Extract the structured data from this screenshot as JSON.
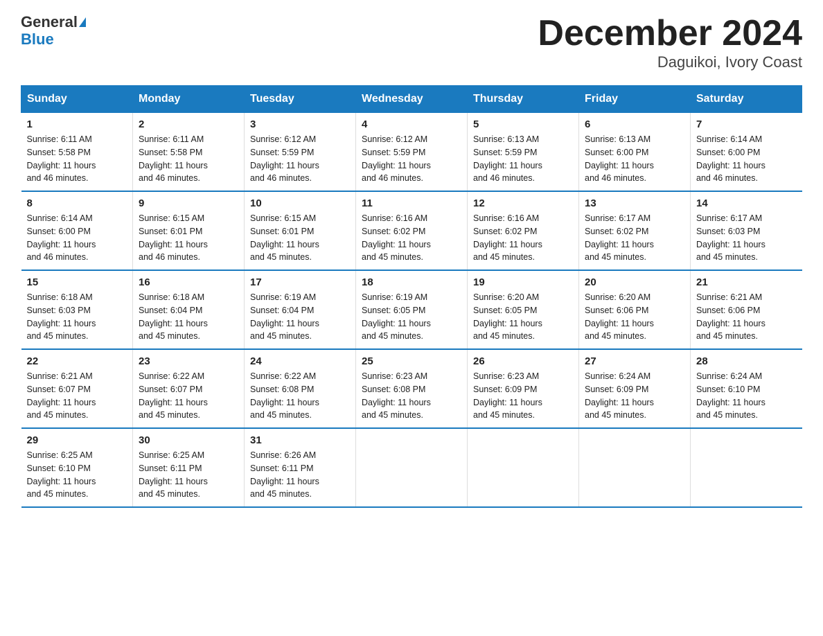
{
  "header": {
    "logo_line1": "General",
    "logo_line2": "Blue",
    "title": "December 2024",
    "subtitle": "Daguikoi, Ivory Coast"
  },
  "days_of_week": [
    "Sunday",
    "Monday",
    "Tuesday",
    "Wednesday",
    "Thursday",
    "Friday",
    "Saturday"
  ],
  "weeks": [
    [
      {
        "day": "1",
        "info": "Sunrise: 6:11 AM\nSunset: 5:58 PM\nDaylight: 11 hours\nand 46 minutes."
      },
      {
        "day": "2",
        "info": "Sunrise: 6:11 AM\nSunset: 5:58 PM\nDaylight: 11 hours\nand 46 minutes."
      },
      {
        "day": "3",
        "info": "Sunrise: 6:12 AM\nSunset: 5:59 PM\nDaylight: 11 hours\nand 46 minutes."
      },
      {
        "day": "4",
        "info": "Sunrise: 6:12 AM\nSunset: 5:59 PM\nDaylight: 11 hours\nand 46 minutes."
      },
      {
        "day": "5",
        "info": "Sunrise: 6:13 AM\nSunset: 5:59 PM\nDaylight: 11 hours\nand 46 minutes."
      },
      {
        "day": "6",
        "info": "Sunrise: 6:13 AM\nSunset: 6:00 PM\nDaylight: 11 hours\nand 46 minutes."
      },
      {
        "day": "7",
        "info": "Sunrise: 6:14 AM\nSunset: 6:00 PM\nDaylight: 11 hours\nand 46 minutes."
      }
    ],
    [
      {
        "day": "8",
        "info": "Sunrise: 6:14 AM\nSunset: 6:00 PM\nDaylight: 11 hours\nand 46 minutes."
      },
      {
        "day": "9",
        "info": "Sunrise: 6:15 AM\nSunset: 6:01 PM\nDaylight: 11 hours\nand 46 minutes."
      },
      {
        "day": "10",
        "info": "Sunrise: 6:15 AM\nSunset: 6:01 PM\nDaylight: 11 hours\nand 45 minutes."
      },
      {
        "day": "11",
        "info": "Sunrise: 6:16 AM\nSunset: 6:02 PM\nDaylight: 11 hours\nand 45 minutes."
      },
      {
        "day": "12",
        "info": "Sunrise: 6:16 AM\nSunset: 6:02 PM\nDaylight: 11 hours\nand 45 minutes."
      },
      {
        "day": "13",
        "info": "Sunrise: 6:17 AM\nSunset: 6:02 PM\nDaylight: 11 hours\nand 45 minutes."
      },
      {
        "day": "14",
        "info": "Sunrise: 6:17 AM\nSunset: 6:03 PM\nDaylight: 11 hours\nand 45 minutes."
      }
    ],
    [
      {
        "day": "15",
        "info": "Sunrise: 6:18 AM\nSunset: 6:03 PM\nDaylight: 11 hours\nand 45 minutes."
      },
      {
        "day": "16",
        "info": "Sunrise: 6:18 AM\nSunset: 6:04 PM\nDaylight: 11 hours\nand 45 minutes."
      },
      {
        "day": "17",
        "info": "Sunrise: 6:19 AM\nSunset: 6:04 PM\nDaylight: 11 hours\nand 45 minutes."
      },
      {
        "day": "18",
        "info": "Sunrise: 6:19 AM\nSunset: 6:05 PM\nDaylight: 11 hours\nand 45 minutes."
      },
      {
        "day": "19",
        "info": "Sunrise: 6:20 AM\nSunset: 6:05 PM\nDaylight: 11 hours\nand 45 minutes."
      },
      {
        "day": "20",
        "info": "Sunrise: 6:20 AM\nSunset: 6:06 PM\nDaylight: 11 hours\nand 45 minutes."
      },
      {
        "day": "21",
        "info": "Sunrise: 6:21 AM\nSunset: 6:06 PM\nDaylight: 11 hours\nand 45 minutes."
      }
    ],
    [
      {
        "day": "22",
        "info": "Sunrise: 6:21 AM\nSunset: 6:07 PM\nDaylight: 11 hours\nand 45 minutes."
      },
      {
        "day": "23",
        "info": "Sunrise: 6:22 AM\nSunset: 6:07 PM\nDaylight: 11 hours\nand 45 minutes."
      },
      {
        "day": "24",
        "info": "Sunrise: 6:22 AM\nSunset: 6:08 PM\nDaylight: 11 hours\nand 45 minutes."
      },
      {
        "day": "25",
        "info": "Sunrise: 6:23 AM\nSunset: 6:08 PM\nDaylight: 11 hours\nand 45 minutes."
      },
      {
        "day": "26",
        "info": "Sunrise: 6:23 AM\nSunset: 6:09 PM\nDaylight: 11 hours\nand 45 minutes."
      },
      {
        "day": "27",
        "info": "Sunrise: 6:24 AM\nSunset: 6:09 PM\nDaylight: 11 hours\nand 45 minutes."
      },
      {
        "day": "28",
        "info": "Sunrise: 6:24 AM\nSunset: 6:10 PM\nDaylight: 11 hours\nand 45 minutes."
      }
    ],
    [
      {
        "day": "29",
        "info": "Sunrise: 6:25 AM\nSunset: 6:10 PM\nDaylight: 11 hours\nand 45 minutes."
      },
      {
        "day": "30",
        "info": "Sunrise: 6:25 AM\nSunset: 6:11 PM\nDaylight: 11 hours\nand 45 minutes."
      },
      {
        "day": "31",
        "info": "Sunrise: 6:26 AM\nSunset: 6:11 PM\nDaylight: 11 hours\nand 45 minutes."
      },
      {
        "day": "",
        "info": ""
      },
      {
        "day": "",
        "info": ""
      },
      {
        "day": "",
        "info": ""
      },
      {
        "day": "",
        "info": ""
      }
    ]
  ]
}
